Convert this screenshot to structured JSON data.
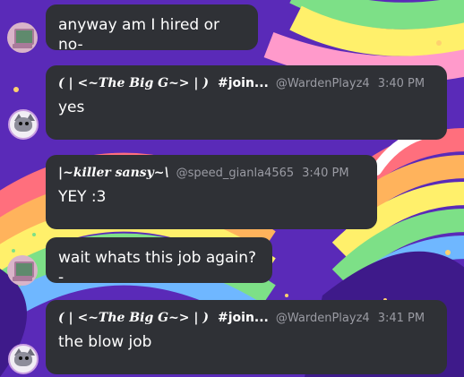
{
  "messages": [
    {
      "text": "anyway am I hired or no-"
    },
    {
      "username": "( | <~The Big G~> | )",
      "channel": "#join...",
      "handle": "@WardenPlayz4",
      "time": "3:40 PM",
      "text": "yes"
    },
    {
      "username": "|~killer sansy~\\",
      "handle": "@speed_gianla4565",
      "time": "3:40 PM",
      "text": "YEY :3"
    },
    {
      "text": "wait whats this job again?-"
    },
    {
      "username": "( | <~The Big G~> | )",
      "channel": "#join...",
      "handle": "@WardenPlayz4",
      "time": "3:41 PM",
      "text": "the blow job"
    }
  ],
  "colors": {
    "bubble": "#2f3136",
    "meta": "#9a9ba3",
    "background": "#5a2ab8"
  },
  "avatars": [
    "computer-avatar",
    "cat-avatar",
    "computer-avatar",
    "cat-avatar"
  ]
}
